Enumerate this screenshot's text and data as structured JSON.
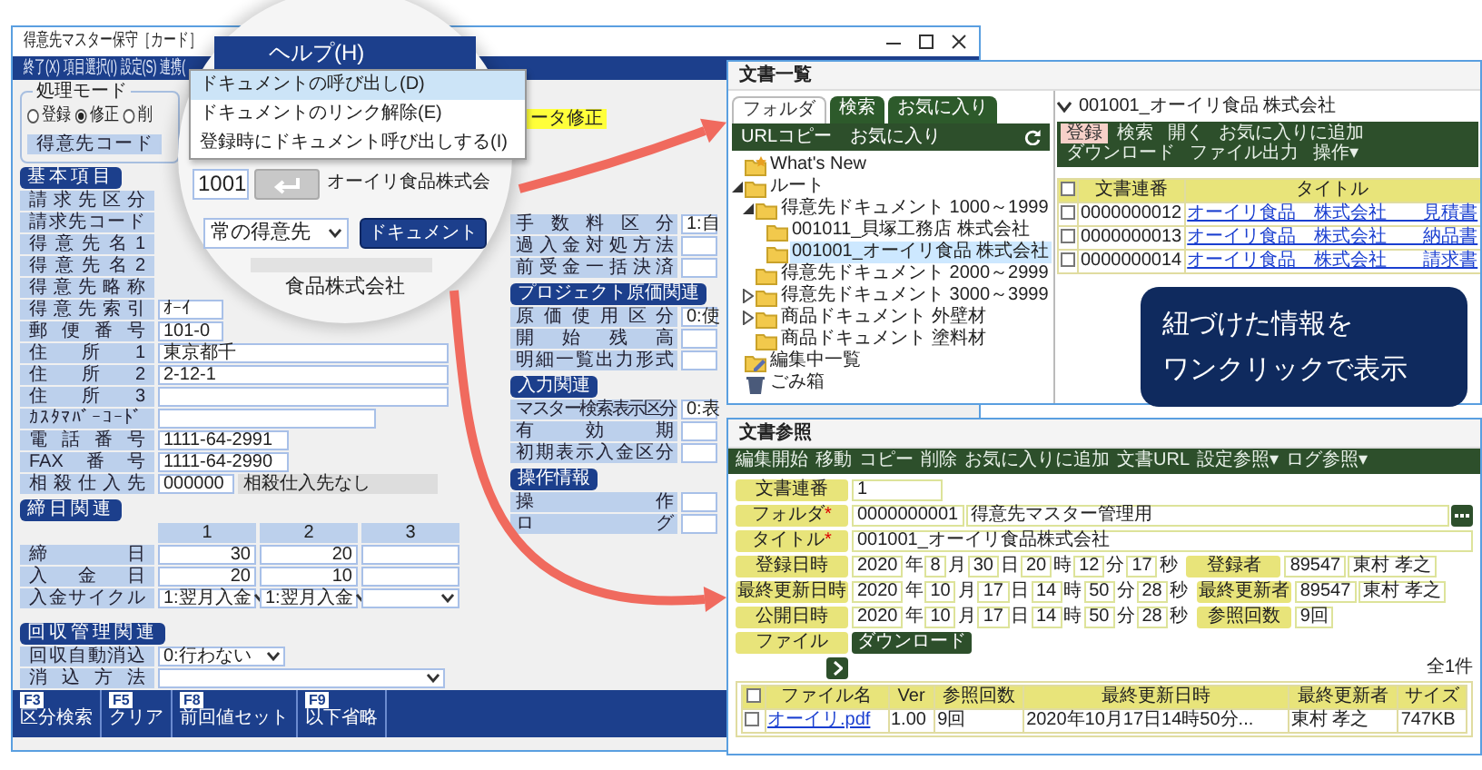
{
  "main_window": {
    "title": "得意先マスター保守［カード］",
    "menu": [
      "終了(X)",
      "項目選択(I)",
      "設定(S)",
      "連携("
    ],
    "mode_group": {
      "label": "処理モード",
      "options": [
        {
          "label": "登録",
          "selected": false
        },
        {
          "label": "修正",
          "selected": true
        },
        {
          "label": "削",
          "selected": false
        }
      ]
    },
    "code_label": "得意先コード",
    "status_tag": "ータ修正",
    "basic": {
      "heading": "基本項目",
      "rows": [
        {
          "label": "請求先区分"
        },
        {
          "label": "請求先コード"
        },
        {
          "label": "得意先名1"
        },
        {
          "label": "得意先名2"
        },
        {
          "label": "得意先略称"
        },
        {
          "label": "得意先索引",
          "kind": "short",
          "value": "ｵｰｲ"
        },
        {
          "label": "郵便番号",
          "kind": "short",
          "value": "101-0"
        },
        {
          "label": "住所1",
          "kind": "long",
          "value": "東京都千"
        },
        {
          "label": "住所2",
          "kind": "long",
          "value": "2-12-1"
        },
        {
          "label": "住所3",
          "kind": "long"
        },
        {
          "label": "ｶｽﾀﾏﾊﾞｰｺｰﾄﾞ",
          "kind": "mid"
        },
        {
          "label": "電話番号",
          "kind": "phone",
          "value": "1111-64-2991"
        },
        {
          "label": "FAX番号",
          "kind": "phone",
          "value": "1111-64-2990"
        },
        {
          "label": "相殺仕入先",
          "kind": "pair",
          "value": "000000",
          "note": "相殺仕入先なし"
        }
      ]
    },
    "closing": {
      "heading": "締日関連",
      "columns": [
        "1",
        "2",
        "3"
      ],
      "rows": [
        {
          "label": "締日",
          "kind": "input",
          "values": [
            "30",
            "20"
          ]
        },
        {
          "label": "入金日",
          "kind": "input",
          "values": [
            "20",
            "10"
          ]
        },
        {
          "label": "入金サイクル",
          "kind": "select",
          "values": [
            "1:翌月入金",
            "1:翌月入金"
          ]
        }
      ]
    },
    "collection": {
      "heading": "回収管理関連",
      "rows": [
        {
          "label": "回収自動消込",
          "kind": "select",
          "value": "0:行わない"
        },
        {
          "label": "消込方法",
          "kind": "select"
        }
      ]
    },
    "right_sections": [
      {
        "rows": [
          {
            "label": "手数料区分",
            "value": "1:自"
          },
          {
            "label": "過入金対処方法"
          },
          {
            "label": "前受金一括決済"
          }
        ]
      },
      {
        "heading": "プロジェクト原価関連",
        "rows": [
          {
            "label": "原価使用区分",
            "value": "0:使"
          },
          {
            "label": "開始残高"
          },
          {
            "label": "明細一覧出力形式"
          }
        ]
      },
      {
        "heading": "入力関連",
        "rows": [
          {
            "label": "マスター検索表示区分",
            "value": "0:表"
          },
          {
            "label": "有効期"
          },
          {
            "label": "初期表示入金区分"
          }
        ]
      },
      {
        "heading": "操作情報",
        "rows": [
          {
            "label": "操作"
          },
          {
            "label": "ログ"
          }
        ]
      }
    ],
    "fkeys": [
      {
        "key": "F3",
        "label": "区分検索"
      },
      {
        "key": "F5",
        "label": "クリア"
      },
      {
        "key": "F8",
        "label": "前回値セット"
      },
      {
        "key": "F9",
        "label": "以下省略"
      }
    ]
  },
  "magnifier": {
    "menu_title": "ヘルプ(H)",
    "items": [
      {
        "label": "ドキュメントの呼び出し(D)",
        "selected": true
      },
      {
        "label": "ドキュメントのリンク解除(E)",
        "selected": false
      },
      {
        "label": "登録時にドキュメント呼び出しする(I)",
        "selected": false
      }
    ],
    "code": "1001",
    "name": "オーイリ食品株式会",
    "select": "常の得意先",
    "button": "ドキュメント",
    "address": "食品株式会社"
  },
  "doc_list": {
    "title": "文書一覧",
    "tabs": [
      {
        "label": "フォルダ",
        "selected": true
      },
      {
        "label": "検索",
        "selected": false
      },
      {
        "label": "お気に入り",
        "selected": false
      }
    ],
    "bar": [
      "URLコピー",
      "お気に入り"
    ],
    "tree": [
      {
        "label": "What's New",
        "kind": "new",
        "selected": false
      },
      {
        "label": "ルート",
        "kind": "folder",
        "selected": false,
        "expanded": true,
        "children": [
          {
            "label": "得意先ドキュメント 1000～1999",
            "kind": "folder",
            "selected": false,
            "expanded": true,
            "children": [
              {
                "label": "001011_貝塚工務店 株式会社",
                "kind": "folder",
                "selected": false
              },
              {
                "label": "001001_オーイリ食品 株式会社",
                "kind": "folder",
                "selected": true
              }
            ]
          },
          {
            "label": "得意先ドキュメント 2000～2999",
            "kind": "folder",
            "selected": false
          },
          {
            "label": "得意先ドキュメント 3000～3999",
            "kind": "folder",
            "selected": false,
            "expanded": false
          },
          {
            "label": "商品ドキュメント 外壁材",
            "kind": "folder",
            "selected": false,
            "expanded": false
          },
          {
            "label": "商品ドキュメント 塗料材",
            "kind": "folder",
            "selected": false
          }
        ]
      },
      {
        "label": "編集中一覧",
        "kind": "editing",
        "selected": false
      },
      {
        "label": "ごみ箱",
        "kind": "trash",
        "selected": false
      }
    ],
    "path": "001001_オーイリ食品 株式会社",
    "toolbar": [
      {
        "label": "登録",
        "selected": true
      },
      {
        "label": "検索",
        "selected": false
      },
      {
        "label": "開く",
        "selected": false
      },
      {
        "label": "お気に入りに追加",
        "selected": false
      },
      {
        "label": "ダウンロード",
        "selected": false
      },
      {
        "label": "ファイル出力",
        "selected": false
      },
      {
        "label": "操作▾",
        "selected": false
      }
    ],
    "table": {
      "all_checked": false,
      "columns": [
        "文書連番",
        "タイトル"
      ],
      "rows": [
        {
          "checked": false,
          "number": "0000000012",
          "title": "オーイリ食品　株式会社　　見積書"
        },
        {
          "checked": false,
          "number": "0000000013",
          "title": "オーイリ食品　株式会社　　納品書"
        },
        {
          "checked": false,
          "number": "0000000014",
          "title": "オーイリ食品　株式会社　　請求書"
        }
      ]
    }
  },
  "doc_ref": {
    "title": "文書参照",
    "toolbar": [
      "編集開始",
      "移動",
      "コピー",
      "削除",
      "お気に入りに追加",
      "文書URL",
      "設定参照▾",
      "ログ参照▾"
    ],
    "fields": [
      {
        "label": "文書連番",
        "kind": "text",
        "values": [
          "1"
        ]
      },
      {
        "label": "フォルダ",
        "mark": "*",
        "kind": "folder",
        "values": [
          "0000000001",
          "得意先マスター管理用"
        ]
      },
      {
        "label": "タイトル",
        "mark": "*",
        "kind": "wide",
        "values": [
          "001001_オーイリ食品株式会社"
        ]
      },
      {
        "label": "登録日時",
        "kind": "datetime",
        "parts": [
          {
            "value": "2020",
            "unit": "年"
          },
          {
            "value": "8",
            "unit": "月"
          },
          {
            "value": "30",
            "unit": "日"
          },
          {
            "value": "20",
            "unit": "時"
          },
          {
            "value": "12",
            "unit": "分"
          },
          {
            "value": "17",
            "unit": "秒"
          }
        ],
        "side": {
          "label": "登録者",
          "values": [
            "89547",
            "東村 孝之"
          ]
        }
      },
      {
        "label": "最終更新日時",
        "kind": "datetime",
        "parts": [
          {
            "value": "2020",
            "unit": "年"
          },
          {
            "value": "10",
            "unit": "月"
          },
          {
            "value": "17",
            "unit": "日"
          },
          {
            "value": "14",
            "unit": "時"
          },
          {
            "value": "50",
            "unit": "分"
          },
          {
            "value": "28",
            "unit": "秒"
          }
        ],
        "side": {
          "label": "最終更新者",
          "values": [
            "89547",
            "東村 孝之"
          ]
        }
      },
      {
        "label": "公開日時",
        "kind": "datetime",
        "parts": [
          {
            "value": "2020",
            "unit": "年"
          },
          {
            "value": "10",
            "unit": "月"
          },
          {
            "value": "17",
            "unit": "日"
          },
          {
            "value": "14",
            "unit": "時"
          },
          {
            "value": "50",
            "unit": "分"
          },
          {
            "value": "28",
            "unit": "秒"
          }
        ],
        "side": {
          "label": "参照回数",
          "values": [
            "9回"
          ]
        }
      },
      {
        "label": "ファイル",
        "kind": "button",
        "button": "ダウンロード"
      }
    ],
    "count": "全1件",
    "files": {
      "all_checked": false,
      "columns": [
        "ファイル名",
        "Ver",
        "参照回数",
        "最終更新日時",
        "最終更新者",
        "サイズ"
      ],
      "rows": [
        {
          "checked": false,
          "cells": [
            "オーイリ.pdf",
            "1.00",
            "9回",
            "2020年10月17日14時50分...",
            "東村 孝之",
            "747KB"
          ]
        }
      ]
    }
  },
  "callout": {
    "lines": [
      "紐づけた情報を",
      "ワンクリックで表示"
    ]
  }
}
